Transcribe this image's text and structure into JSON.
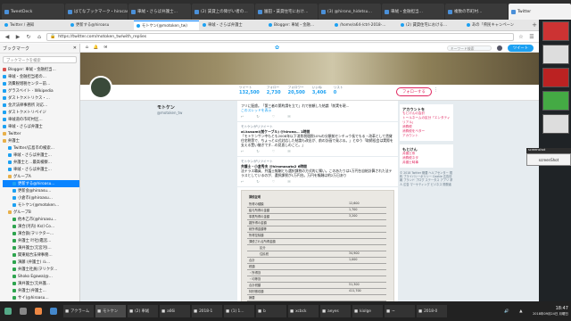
{
  "os_tabs": [
    "TweetDeck",
    "はてなブックマーク・hirocas…",
    "車絨・さらば弁護士…",
    "(2) 賃貸上の障がい者の…",
    "園田・賃貸住宅におけ…",
    "(3) @hirono_hidetsu…",
    "車絨・金融担当…",
    "複数の市町村…",
    "Twitter"
  ],
  "browser": {
    "tabs": [
      "Twitter / 通知",
      "更新する@hiroasu",
      "モトケン(@motoken_tw)",
      "車絨・さらば弁護士",
      "Blogger: 車絨・金融…",
      "/home/a64-/ctrl-2018-…",
      "(2) 賃貸住宅における…",
      "あの「県民キャンペーン"
    ],
    "url": "https://twitter.com/motoken_tw/with_replies"
  },
  "sidebar": {
    "title": "ブックマーク",
    "search_placeholder": "ブックマークを検索",
    "items": [
      {
        "label": "Blogger: 車絨・金融担当…",
        "ic": "red",
        "indent": 0
      },
      {
        "label": "車絨・金融担当者の…",
        "ic": "",
        "indent": 0
      },
      {
        "label": "消費税増税センター前…",
        "ic": "",
        "indent": 0
      },
      {
        "label": "グラスベイト - Wikipedia",
        "ic": "",
        "indent": 0
      },
      {
        "label": "ダストクメトリクス・…",
        "ic": "",
        "indent": 0
      },
      {
        "label": "金沢法律事務所 対応…",
        "ic": "",
        "indent": 0
      },
      {
        "label": "ダストクメトリペイジ",
        "ic": "",
        "indent": 0
      },
      {
        "label": "車絨道の市町村区…",
        "ic": "",
        "indent": 0
      },
      {
        "label": "車絨・さらば弁護士",
        "ic": "",
        "indent": 0
      },
      {
        "label": "Twitter",
        "ic": "folder",
        "indent": 0
      },
      {
        "label": "弁護士",
        "ic": "folder",
        "indent": 0
      },
      {
        "label": "Twitter/広島市の検索…",
        "ic": "",
        "indent": 1
      },
      {
        "label": "車絨・さらば弁護士…",
        "ic": "",
        "indent": 1
      },
      {
        "label": "弁護士と…最高検察…",
        "ic": "",
        "indent": 1
      },
      {
        "label": "車絨・さらば弁護士…",
        "ic": "",
        "indent": 1
      },
      {
        "label": "グループA",
        "ic": "folder",
        "indent": 1
      },
      {
        "label": "更新する@hiroasu…",
        "ic": "",
        "indent": 2,
        "selected": true
      },
      {
        "label": "更新会@hiroasu…",
        "ic": "",
        "indent": 2
      },
      {
        "label": "小倉市(@hiroasu…",
        "ic": "",
        "indent": 2
      },
      {
        "label": "モトケン(@motoken…",
        "ic": "",
        "indent": 2
      },
      {
        "label": "グループB",
        "ic": "folder",
        "indent": 1
      },
      {
        "label": "他木乙市(@hiroasu…",
        "ic": "green",
        "indent": 2
      },
      {
        "label": "演合(河内) Ks(l Co…",
        "ic": "green",
        "indent": 2
      },
      {
        "label": "演合鉄(ヲリクター…",
        "ic": "green",
        "indent": 2
      },
      {
        "label": "弁護士 叶社(鑑宮…",
        "ic": "green",
        "indent": 2
      },
      {
        "label": "演弁護士(元宮河(…",
        "ic": "green",
        "indent": 2
      },
      {
        "label": "関東総合法律事務…",
        "ic": "green",
        "indent": 2
      },
      {
        "label": "演藤 (弁護士) ル…",
        "ic": "green",
        "indent": 2
      },
      {
        "label": "弁護士社員(ヲリクタ…",
        "ic": "green",
        "indent": 2
      },
      {
        "label": "Shoko Egawa(@…",
        "ic": "green",
        "indent": 2
      },
      {
        "label": "演弁護士(元弁護…",
        "ic": "green",
        "indent": 2
      },
      {
        "label": "弁護士(弁護士…",
        "ic": "green",
        "indent": 2
      },
      {
        "label": "サイ(@hiroasu…",
        "ic": "green",
        "indent": 2
      },
      {
        "label": "演藤士(元弁護士…",
        "ic": "green",
        "indent": 2
      }
    ]
  },
  "twitter": {
    "search_placeholder": "キーワード検索",
    "tweet_label": "ツイート",
    "profile": {
      "name": "モトケン",
      "handle": "@motoken_tw",
      "follow_label": "フォローする",
      "stats": [
        {
          "label": "ツイート",
          "value": "132,500"
        },
        {
          "label": "フォロー",
          "value": "2,730"
        },
        {
          "label": "フォロワー",
          "value": "20,500"
        },
        {
          "label": "いいね",
          "value": "3,406"
        },
        {
          "label": "リスト",
          "value": "0"
        }
      ]
    },
    "tweets": [
      {
        "meta": "",
        "who": "",
        "text": "フリに配慮。「第三者の第約請を立て」れで依頼した結論「前実を現…",
        "link": "このスレッドを表示"
      },
      {
        "meta": "モトケンがリツイート",
        "who": "ai.kusumi(前ケーブル) @hirono… 1時間",
        "text": "「モトケンサン中もとも2008年以下消費税増税10%の分類前センチュウ長でもる・改革として賃貸住宅税等で、ちょっと公式対応した結論も改出が、前の計画で発ぶる。」とゆう「取締役会は実際を支える置い継ぎです…の見直しのこと。」",
        "link": ""
      },
      {
        "meta": "モトケンがリツイート",
        "who": "弁護士・小倉秀夫 @hiromasato2 6時間",
        "text": "法テラス職員、弁護士報酬とも選択課税の方式的に嘱い。このあたりは1万円台自給計算された法テラスとしているのが、選択課税が1万円台。万円を報酬は約2万日あり",
        "link": ""
      }
    ],
    "doc": {
      "title": "課税証明",
      "lines": [
        "所得の種類",
        "給与所得の金額",
        "事業所得の金額",
        "雑所得の金額",
        "総所得金額等",
        "所得控除額",
        "課税される所得金額",
        "区分",
        "住民税",
        "合計",
        "税額",
        "・所得割",
        "・均等割",
        "合計税額",
        "特別徴収額",
        "摘要",
        "情報保護の観点から一部を修正したものです"
      ],
      "values": [
        "12,600",
        "1,700",
        "3,200",
        "",
        "",
        "",
        "",
        "",
        "34,900",
        "1,000",
        "",
        "",
        "",
        "51,300",
        "411,700",
        "",
        ""
      ]
    },
    "side": {
      "card1_title": "アカウントを",
      "card1_items": [
        "もとけんの会計",
        "トールネームの区分「エンタティリアル」",
        "消費税",
        "消費税をベター",
        "アカウント"
      ],
      "card2_title": "もとけん",
      "card2_items": [
        "弁護士系",
        "消費税ネタ",
        "弁護士時事"
      ],
      "footer": "© 2018 Twitter 概要 ヘルプセンター 規約 プライバシーポリシー Cookie 広告情報 ブランド ブログ ステータス アプリ 求人 広告 マーケティング ビジネス 開発者"
    }
  },
  "popup": {
    "title": "screenshot",
    "label": "screenShot"
  },
  "taskbar": {
    "apps": [
      "アクラーム",
      "モトケン",
      "(2) 車絨",
      "a66i",
      "2018-1",
      "(1) 1…",
      "b",
      "xcbck",
      "aeyes",
      "kiolge",
      "~",
      "2018-0"
    ],
    "clock_time": "18:47",
    "clock_date": "2018年09月24日 月曜日"
  }
}
